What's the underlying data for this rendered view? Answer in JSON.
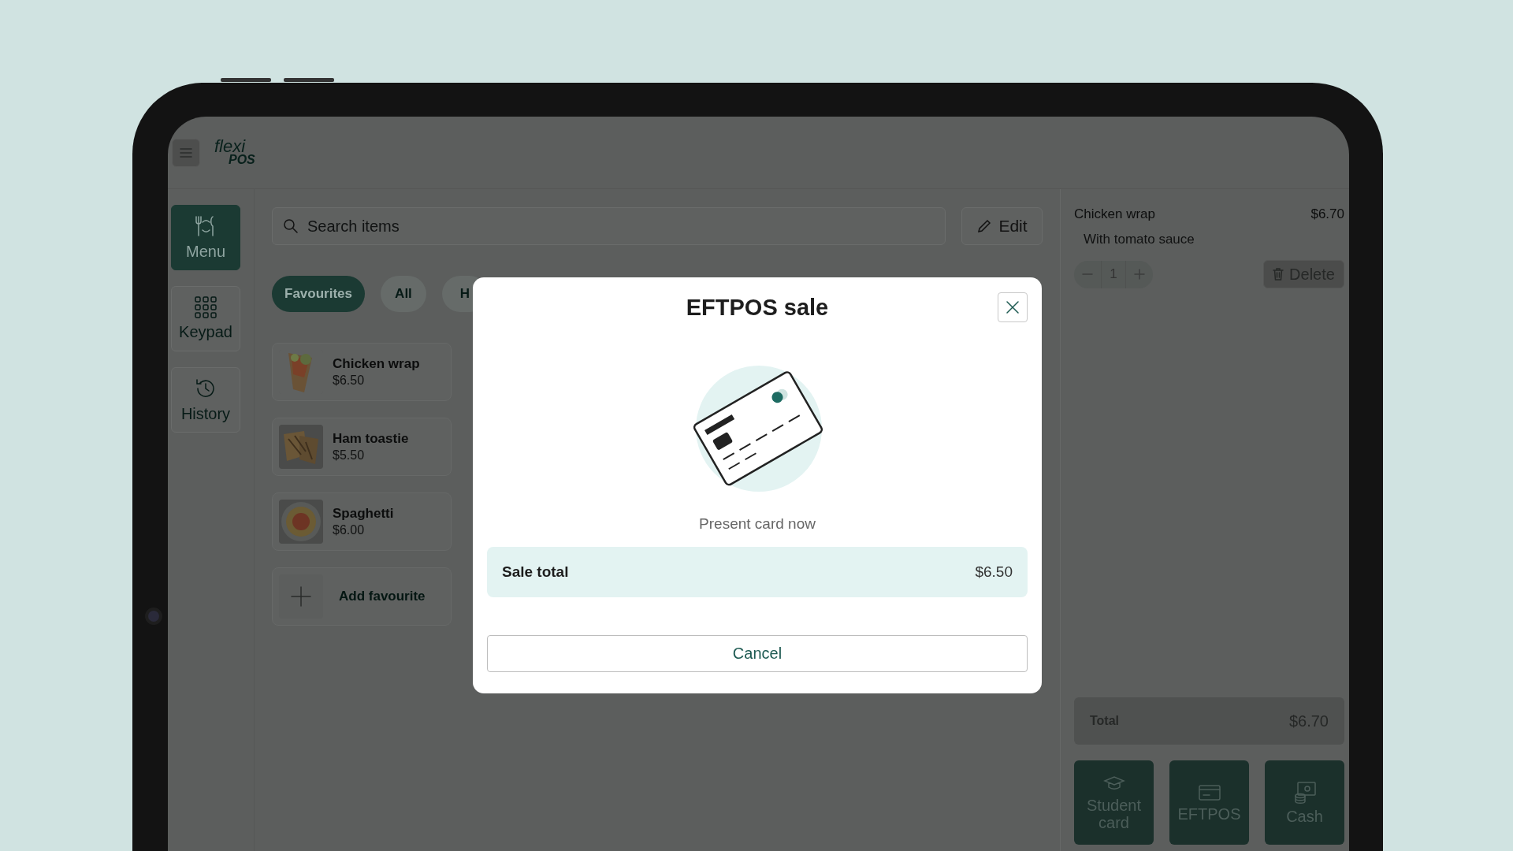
{
  "header": {
    "logo_top": "flexi",
    "logo_bottom": "POS"
  },
  "nav": [
    {
      "label": "Menu",
      "selected": true
    },
    {
      "label": "Keypad",
      "selected": false
    },
    {
      "label": "History",
      "selected": false
    }
  ],
  "search": {
    "placeholder": "Search items"
  },
  "edit_button": "Edit",
  "categories": [
    {
      "label": "Favourites",
      "selected": true
    },
    {
      "label": "All",
      "selected": false
    },
    {
      "label": "H",
      "selected": false
    }
  ],
  "items": [
    {
      "kind": "product",
      "name": "Chicken wrap",
      "price": "$6.50"
    },
    {
      "kind": "product",
      "name": "Ham toastie",
      "price": "$5.50"
    },
    {
      "kind": "product",
      "name": "Spaghetti",
      "price": "$6.00"
    },
    {
      "kind": "add",
      "name": "Add favourite"
    }
  ],
  "order": {
    "lines": [
      {
        "name": "Chicken wrap",
        "price": "$6.70",
        "note": "With tomato sauce",
        "quantity": "1",
        "delete": "Delete"
      }
    ],
    "total_label": "Total",
    "total": "$6.70"
  },
  "payments": [
    {
      "label": "Student card"
    },
    {
      "label": "EFTPOS"
    },
    {
      "label": "Cash"
    }
  ],
  "modal": {
    "title": "EFTPOS sale",
    "message": "Present card now",
    "total_label": "Sale total",
    "total": "$6.50",
    "cancel": "Cancel"
  }
}
